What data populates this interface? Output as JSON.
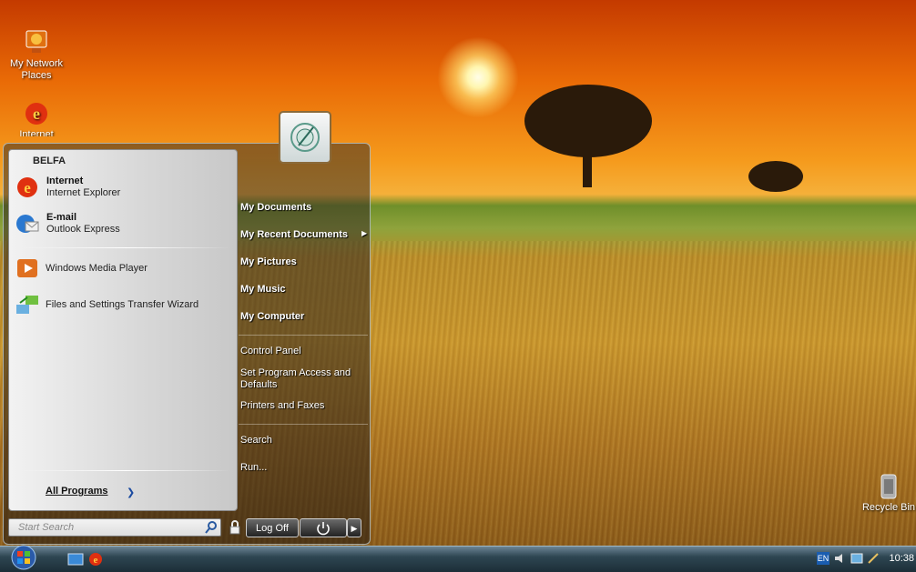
{
  "desktop": {
    "icons": [
      {
        "label": "My Network Places",
        "icon": "network-places-icon"
      },
      {
        "label": "Internet",
        "icon": "internet-explorer-icon"
      },
      {
        "label": "Recycle Bin",
        "icon": "recycle-bin-icon"
      }
    ]
  },
  "start_menu": {
    "user_name": "BELFA",
    "pinned": [
      {
        "title": "Internet",
        "subtitle": "Internet Explorer",
        "icon": "internet-explorer-icon"
      },
      {
        "title": "E-mail",
        "subtitle": "Outlook Express",
        "icon": "outlook-express-icon"
      }
    ],
    "recent": [
      {
        "label": "Windows Media Player",
        "icon": "media-player-icon"
      },
      {
        "label": "Files and Settings Transfer Wizard",
        "icon": "transfer-wizard-icon"
      }
    ],
    "all_programs": "All Programs",
    "right": {
      "my_documents": "My Documents",
      "my_recent_documents": "My Recent Documents",
      "my_pictures": "My Pictures",
      "my_music": "My Music",
      "my_computer": "My Computer",
      "control_panel": "Control Panel",
      "set_program_access": "Set Program Access and Defaults",
      "printers_faxes": "Printers and Faxes",
      "search": "Search",
      "run": "Run..."
    },
    "search_placeholder": "Start Search",
    "log_off": "Log Off"
  },
  "taskbar": {
    "language": "EN",
    "clock": "10:38"
  }
}
